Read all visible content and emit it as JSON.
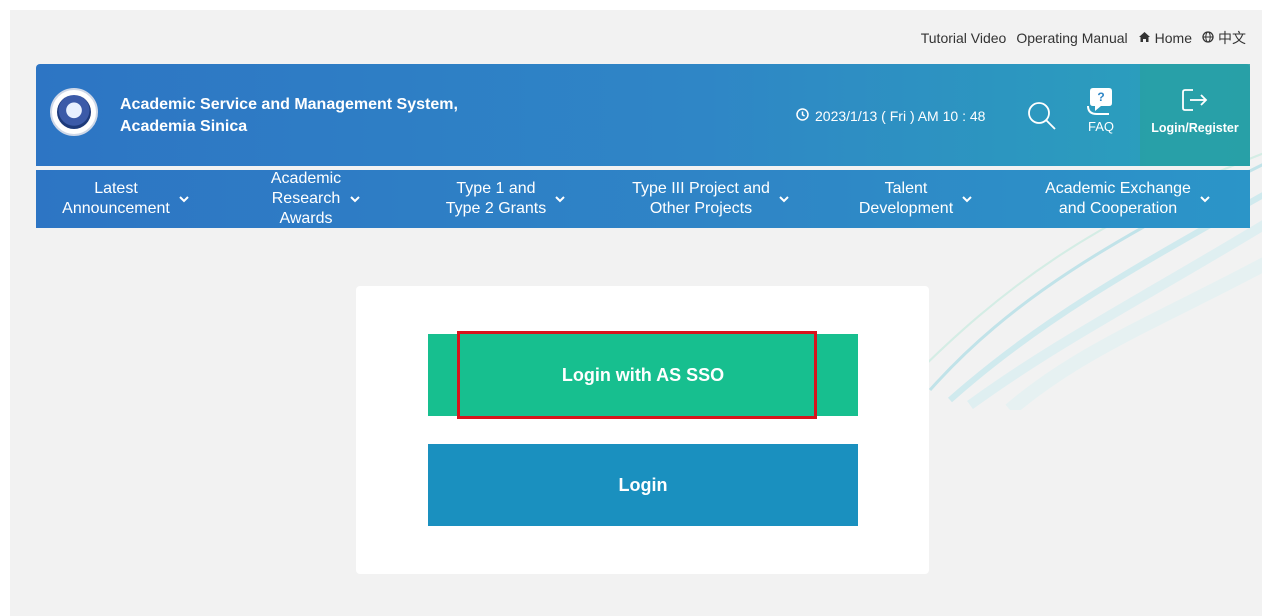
{
  "toplinks": {
    "tutorial": "Tutorial Video",
    "manual": "Operating Manual",
    "home": "Home",
    "language": "中文"
  },
  "header": {
    "title": "Academic Service and Management System,\nAcademia Sinica",
    "datetime": "2023/1/13 ( Fri ) AM 10 : 48",
    "faq": "FAQ",
    "login_register": "Login/Register"
  },
  "nav": {
    "items": [
      {
        "label": "Latest\nAnnouncement"
      },
      {
        "label": "Academic\nResearch\nAwards"
      },
      {
        "label": "Type 1 and\nType 2 Grants"
      },
      {
        "label": "Type III Project and\nOther Projects"
      },
      {
        "label": "Talent\nDevelopment"
      },
      {
        "label": "Academic Exchange\nand Cooperation"
      }
    ]
  },
  "login_card": {
    "sso_button": "Login with AS SSO",
    "login_button": "Login"
  },
  "colors": {
    "header_blue": "#2d75c4",
    "sso_green": "#17bf8f",
    "login_blue": "#1a90bf",
    "highlight_red": "#d8141c"
  }
}
